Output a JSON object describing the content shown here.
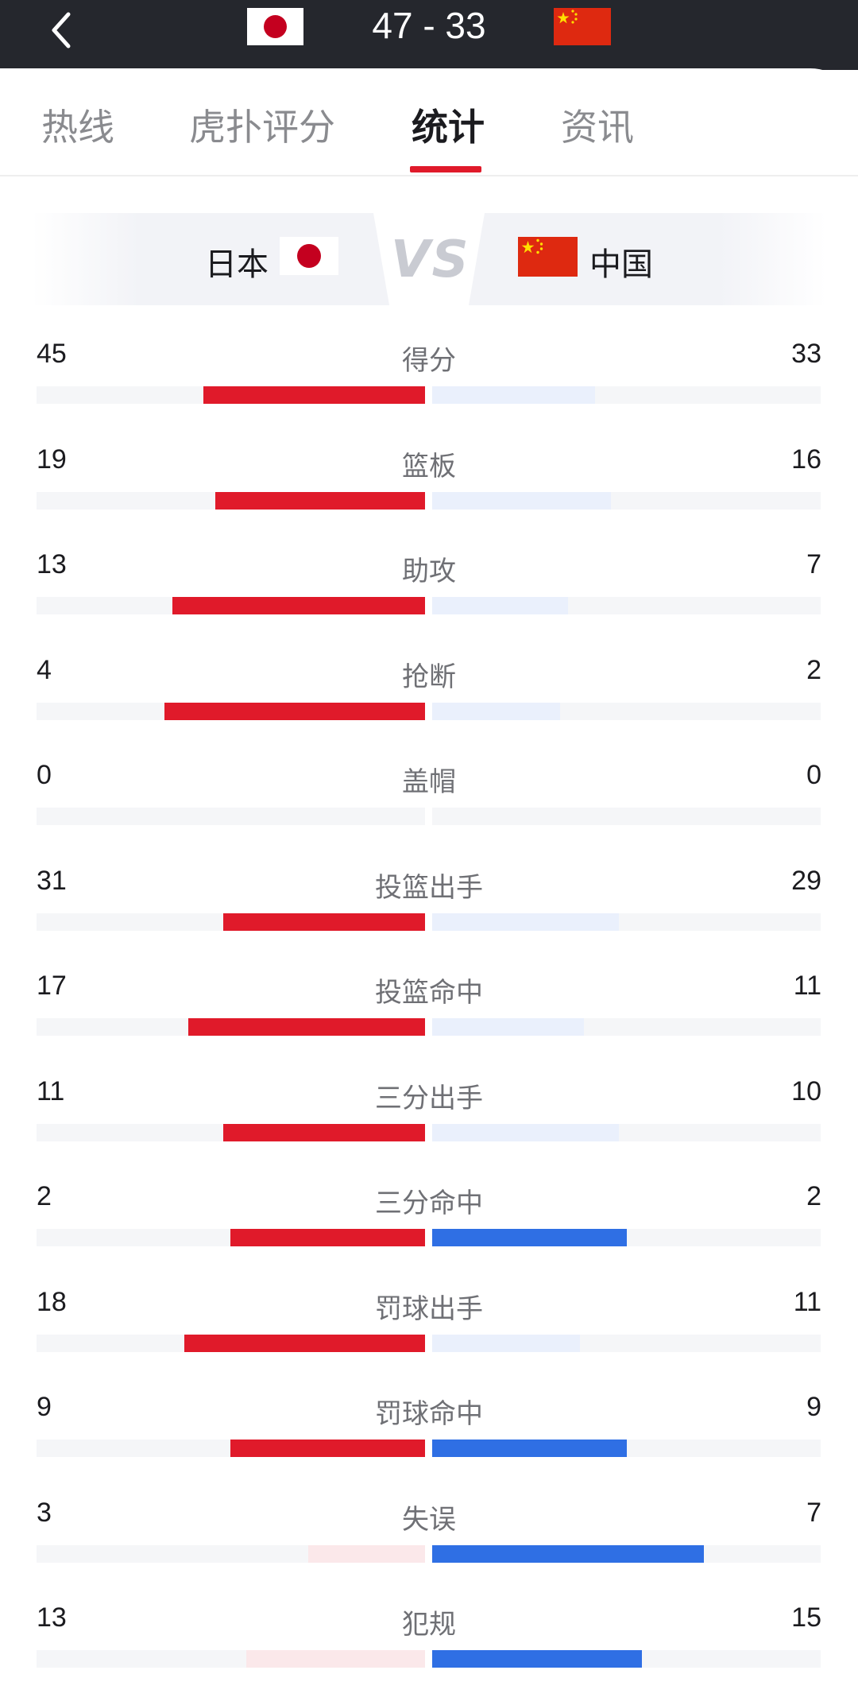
{
  "header": {
    "score": "47 - 33",
    "home_flag_icon": "japan-flag-icon",
    "away_flag_icon": "china-flag-icon",
    "back_icon": "chevron-left-icon"
  },
  "tabs": [
    {
      "label": "热线",
      "active": false
    },
    {
      "label": "虎扑评分",
      "active": false
    },
    {
      "label": "统计",
      "active": true
    },
    {
      "label": "资讯",
      "active": false
    }
  ],
  "teams": {
    "home": "日本",
    "away": "中国",
    "vs": "VS"
  },
  "colors": {
    "home_strong": "#e01a2a",
    "home_weak": "#fbe8ea",
    "away_strong": "#2f6fe4",
    "away_weak": "#eaf0fc",
    "track": "#f5f6f8"
  },
  "stats": [
    {
      "label": "得分",
      "home": "45",
      "away": "33",
      "home_frac": 0.57,
      "away_frac": 0.42,
      "leader": "home"
    },
    {
      "label": "篮板",
      "home": "19",
      "away": "16",
      "home_frac": 0.54,
      "away_frac": 0.46,
      "leader": "home"
    },
    {
      "label": "助攻",
      "home": "13",
      "away": "7",
      "home_frac": 0.65,
      "away_frac": 0.35,
      "leader": "home"
    },
    {
      "label": "抢断",
      "home": "4",
      "away": "2",
      "home_frac": 0.67,
      "away_frac": 0.33,
      "leader": "home"
    },
    {
      "label": "盖帽",
      "home": "0",
      "away": "0",
      "home_frac": 0,
      "away_frac": 0,
      "leader": "none"
    },
    {
      "label": "投篮出手",
      "home": "31",
      "away": "29",
      "home_frac": 0.52,
      "away_frac": 0.48,
      "leader": "home"
    },
    {
      "label": "投篮命中",
      "home": "17",
      "away": "11",
      "home_frac": 0.61,
      "away_frac": 0.39,
      "leader": "home"
    },
    {
      "label": "三分出手",
      "home": "11",
      "away": "10",
      "home_frac": 0.52,
      "away_frac": 0.48,
      "leader": "home"
    },
    {
      "label": "三分命中",
      "home": "2",
      "away": "2",
      "home_frac": 0.5,
      "away_frac": 0.5,
      "leader": "tie"
    },
    {
      "label": "罚球出手",
      "home": "18",
      "away": "11",
      "home_frac": 0.62,
      "away_frac": 0.38,
      "leader": "home"
    },
    {
      "label": "罚球命中",
      "home": "9",
      "away": "9",
      "home_frac": 0.5,
      "away_frac": 0.5,
      "leader": "tie"
    },
    {
      "label": "失误",
      "home": "3",
      "away": "7",
      "home_frac": 0.3,
      "away_frac": 0.7,
      "leader": "away"
    },
    {
      "label": "犯规",
      "home": "13",
      "away": "15",
      "home_frac": 0.46,
      "away_frac": 0.54,
      "leader": "away"
    }
  ]
}
